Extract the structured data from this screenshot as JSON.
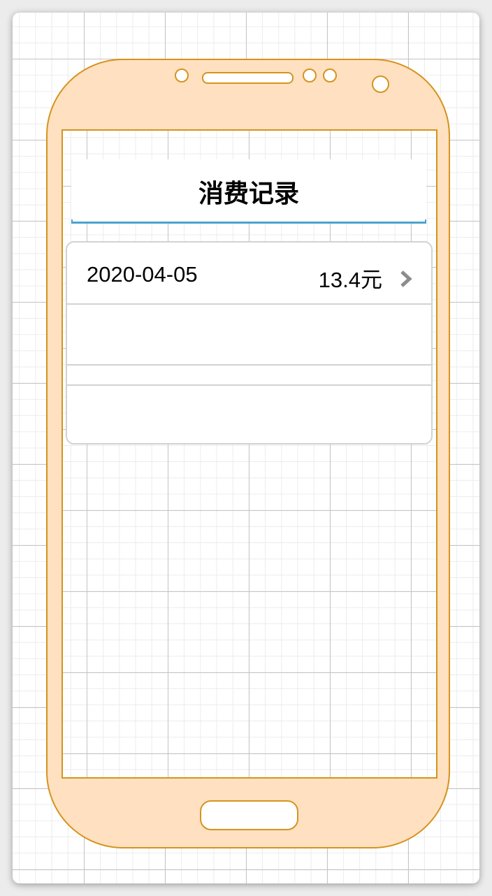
{
  "screen": {
    "title": "消费记录"
  },
  "records": [
    {
      "date": "2020-04-05",
      "amount": "13.4元"
    }
  ],
  "colors": {
    "phone_body": "#ffe0c0",
    "phone_stroke": "#d4941e",
    "title_underline": "#4aa3cf",
    "list_border": "#d2d2d2",
    "chevron": "#8c8c8c"
  },
  "icons": {
    "row_arrow": "chevron-right-icon"
  }
}
